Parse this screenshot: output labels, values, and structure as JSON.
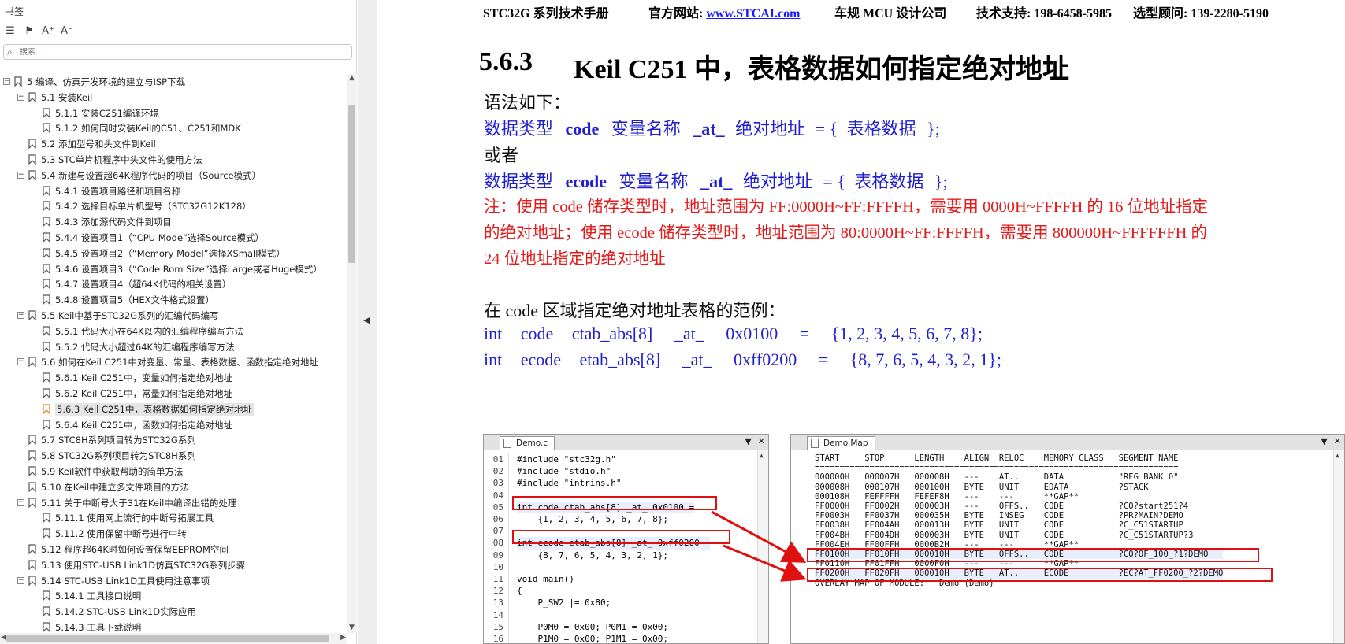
{
  "sidebar": {
    "title": "书签",
    "tools": [
      "list-icon",
      "bookmark-icon",
      "font-increase-icon",
      "font-decrease-icon"
    ],
    "search_placeholder": "搜索...",
    "items": [
      {
        "level": 0,
        "toggle": "-",
        "label": "5  编译、仿真开发环境的建立与ISP下载"
      },
      {
        "level": 1,
        "toggle": "-",
        "label": "5.1 安装Keil"
      },
      {
        "level": 2,
        "toggle": "",
        "label": "5.1.1 安装C251编译环境"
      },
      {
        "level": 2,
        "toggle": "",
        "label": "5.1.2  如何同时安装Keil的C51、C251和MDK"
      },
      {
        "level": 1,
        "toggle": "",
        "label": "5.2  添加型号和头文件到Keil"
      },
      {
        "level": 1,
        "toggle": "",
        "label": "5.3  STC单片机程序中头文件的使用方法"
      },
      {
        "level": 1,
        "toggle": "-",
        "label": "5.4  新建与设置超64K程序代码的项目（Source模式）"
      },
      {
        "level": 2,
        "toggle": "",
        "label": "5.4.1 设置项目路径和项目名称"
      },
      {
        "level": 2,
        "toggle": "",
        "label": "5.4.2 选择目标单片机型号（STC32G12K128）"
      },
      {
        "level": 2,
        "toggle": "",
        "label": "5.4.3 添加源代码文件到项目"
      },
      {
        "level": 2,
        "toggle": "",
        "label": "5.4.4 设置项目1（“CPU Mode”选择Source模式）"
      },
      {
        "level": 2,
        "toggle": "",
        "label": "5.4.5 设置项目2（“Memory Model”选择XSmall模式）"
      },
      {
        "level": 2,
        "toggle": "",
        "label": "5.4.6  设置项目3（“Code Rom Size”选择Large或者Huge模式）"
      },
      {
        "level": 2,
        "toggle": "",
        "label": "5.4.7  设置项目4（超64K代码的相关设置）"
      },
      {
        "level": 2,
        "toggle": "",
        "label": "5.4.8  设置项目5（HEX文件格式设置）"
      },
      {
        "level": 1,
        "toggle": "-",
        "label": "5.5  Keil中基于STC32G系列的汇编代码编写"
      },
      {
        "level": 2,
        "toggle": "",
        "label": "5.5.1 代码大小在64K以内的汇编程序编写方法"
      },
      {
        "level": 2,
        "toggle": "",
        "label": "5.5.2 代码大小超过64K的汇编程序编写方法"
      },
      {
        "level": 1,
        "toggle": "-",
        "label": "5.6  如何在Keil C251中对变量、常量、表格数据、函数指定绝对地址"
      },
      {
        "level": 2,
        "toggle": "",
        "label": "5.6.1 Keil C251中，变量如何指定绝对地址"
      },
      {
        "level": 2,
        "toggle": "",
        "label": "5.6.2  Keil C251中，常量如何指定绝对地址"
      },
      {
        "level": 2,
        "toggle": "",
        "label": "5.6.3  Keil C251中，表格数据如何指定绝对地址",
        "selected": true
      },
      {
        "level": 2,
        "toggle": "",
        "label": "5.6.4  Keil C251中，函数如何指定绝对地址"
      },
      {
        "level": 1,
        "toggle": "",
        "label": "5.7  STC8H系列项目转为STC32G系列"
      },
      {
        "level": 1,
        "toggle": "",
        "label": "5.8  STC32G系列项目转为STC8H系列"
      },
      {
        "level": 1,
        "toggle": "",
        "label": "5.9  Keil软件中获取帮助的简单方法"
      },
      {
        "level": 1,
        "toggle": "",
        "label": "5.10  在Keil中建立多文件项目的方法"
      },
      {
        "level": 1,
        "toggle": "-",
        "label": "5.11  关于中断号大于31在Keil中编译出错的处理"
      },
      {
        "level": 2,
        "toggle": "",
        "label": "5.11.1 使用网上流行的中断号拓展工具"
      },
      {
        "level": 2,
        "toggle": "",
        "label": "5.11.2  使用保留中断号进行中转"
      },
      {
        "level": 1,
        "toggle": "",
        "label": "5.12  程序超64K时如何设置保留EEPROM空间"
      },
      {
        "level": 1,
        "toggle": "",
        "label": "5.13  使用STC-USB Link1D仿真STC32G系列步骤"
      },
      {
        "level": 1,
        "toggle": "-",
        "label": "5.14  STC-USB Link1D工具使用注意事项"
      },
      {
        "level": 2,
        "toggle": "",
        "label": "5.14.1 工具接口说明"
      },
      {
        "level": 2,
        "toggle": "",
        "label": "5.14.2  STC-USB Link1D实际应用"
      },
      {
        "level": 2,
        "toggle": "",
        "label": "5.14.3  工具下载说明"
      }
    ]
  },
  "doc": {
    "header": {
      "manual": "STC32G 系列技术手册",
      "site_label": "官方网站:",
      "site_link": "www.STCAI.com",
      "company": "车规 MCU 设计公司",
      "support": "技术支持: 198-6458-5985",
      "advisor": "选型顾问: 139-2280-5190"
    },
    "section_number": "5.6.3",
    "section_title": "Keil C251 中，表格数据如何指定绝对地址",
    "syntax_intro": "语法如下：",
    "syntax1": {
      "type": "数据类型",
      "kw": "code",
      "var": "变量名称",
      "at": "_at_",
      "addr": "绝对地址",
      "eq": "=",
      "lb": "{",
      "data": "表格数据",
      "rb": "};"
    },
    "or": "或者",
    "syntax2": {
      "type": "数据类型",
      "kw": "ecode",
      "var": "变量名称",
      "at": "_at_",
      "addr": "绝对地址",
      "eq": "=",
      "lb": "{",
      "data": "表格数据",
      "rb": "};"
    },
    "note": [
      "注：使用 code 储存类型时，地址范围为 FF:0000H~FF:FFFFH，需要用 0000H~FFFFH 的 16 位地址指定",
      "的绝对地址；使用 ecode 储存类型时，地址范围为 80:0000H~FF:FFFFH，需要用 800000H~FFFFFFH 的",
      "24 位地址指定的绝对地址"
    ],
    "example_intro": "在 code 区域指定绝对地址表格的范例：",
    "example1": {
      "t": "int",
      "kw": "code",
      "name": "ctab_abs[8]",
      "at": "_at_",
      "addr": "0x0100",
      "eq": "=",
      "val": "{1, 2, 3, 4, 5, 6, 7, 8};"
    },
    "example2": {
      "t": "int",
      "kw": "ecode",
      "name": "etab_abs[8]",
      "at": "_at_",
      "addr": "0xff0200",
      "eq": "=",
      "val": "{8, 7, 6, 5, 4, 3, 2, 1};"
    }
  },
  "demo_panel": {
    "tab": "Demo.c",
    "lines": [
      "01",
      "02",
      "03",
      "04",
      "05",
      "06",
      "07",
      "08",
      "09",
      "10",
      "11",
      "12",
      "13",
      "14",
      "15",
      "16"
    ],
    "code": [
      "#include \"stc32g.h\"",
      "#include \"stdio.h\"",
      "#include \"intrins.h\"",
      "",
      "int code ctab_abs[8] _at_ 0x0100 =",
      "    {1, 2, 3, 4, 5, 6, 7, 8};",
      "",
      "int ecode etab_abs[8] _at_ 0xff0200 =",
      "    {8, 7, 6, 5, 4, 3, 2, 1};",
      "",
      "void main()",
      "{",
      "    P_SW2 |= 0x80;",
      "",
      "    P0M0 = 0x00; P0M1 = 0x00;",
      "    P1M0 = 0x00; P1M1 = 0x00;"
    ]
  },
  "map_panel": {
    "tab": "Demo.Map",
    "header": "START     STOP      LENGTH    ALIGN  RELOC    MEMORY CLASS   SEGMENT NAME",
    "rule": "=========================================================================",
    "rows": [
      "000000H   000007H   000008H   ---    AT..     DATA           \"REG BANK 0\"",
      "000008H   000107H   000100H   BYTE   UNIT     EDATA          ?STACK",
      "000108H   FEFFFFH   FEFEF8H   ---    ---      **GAP**",
      "FF0000H   FF0002H   000003H   ---    OFFS..   CODE           ?CO?start251?4",
      "FF0003H   FF0037H   000035H   BYTE   INSEG    CODE           ?PR?MAIN?DEMO",
      "FF0038H   FF004AH   000013H   BYTE   UNIT     CODE           ?C_C51STARTUP",
      "FF004BH   FF004DH   000003H   BYTE   UNIT     CODE           ?C_C51STARTUP?3",
      "FF004EH   FF00FFH   0000B2H   ---    ---      **GAP**",
      "FF0100H   FF010FH   000010H   BYTE   OFFS..   CODE           ?CO?OF_100_?1?DEMO",
      "FF0110H   FF01FFH   0000F0H   ---    ---      **GAP**",
      "FF0200H   FF020FH   000010H   BYTE   AT..     ECODE          ?EC?AT_FF0200_?2?DEMO",
      "",
      "",
      "",
      "OVERLAY MAP OF MODULE:   Demo (Demo)"
    ]
  },
  "colors": {
    "blue_text": "#1f1fd0",
    "red_text": "#e31a1a",
    "annotation_red": "#e01010",
    "link": "#1a1aff"
  }
}
